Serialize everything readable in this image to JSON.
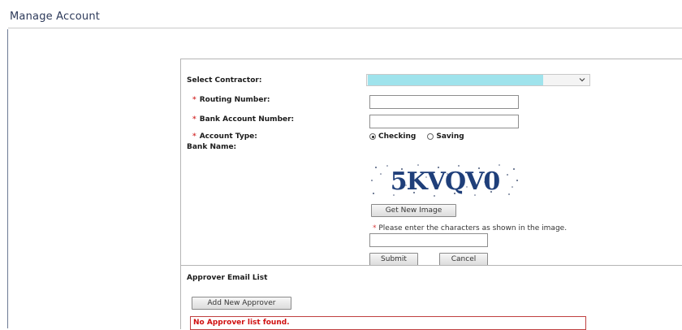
{
  "page": {
    "title": "Manage Account"
  },
  "form": {
    "select_contractor": {
      "label": "Select Contractor:"
    },
    "routing_number": {
      "label": "Routing Number:",
      "required_mark": "*",
      "value": ""
    },
    "bank_account_number": {
      "label": "Bank Account Number:",
      "required_mark": "*",
      "value": ""
    },
    "account_type": {
      "label": "Account Type:",
      "required_mark": "*",
      "options": [
        "Checking",
        "Saving"
      ],
      "selected": "Checking"
    },
    "bank_name": {
      "label": "Bank Name:"
    },
    "captcha": {
      "image_text": "5KVQV0",
      "get_new_image_label": "Get New Image",
      "hint": "* Please enter the characters as shown in the image.",
      "value": ""
    },
    "submit_label": "Submit",
    "cancel_label": "Cancel"
  },
  "approver": {
    "title": "Approver Email List",
    "add_label": "Add New Approver",
    "empty_message": "No Approver list found."
  },
  "colors": {
    "highlight": "#9fe3ec",
    "error": "#d01010",
    "required": "#d63a3a"
  }
}
